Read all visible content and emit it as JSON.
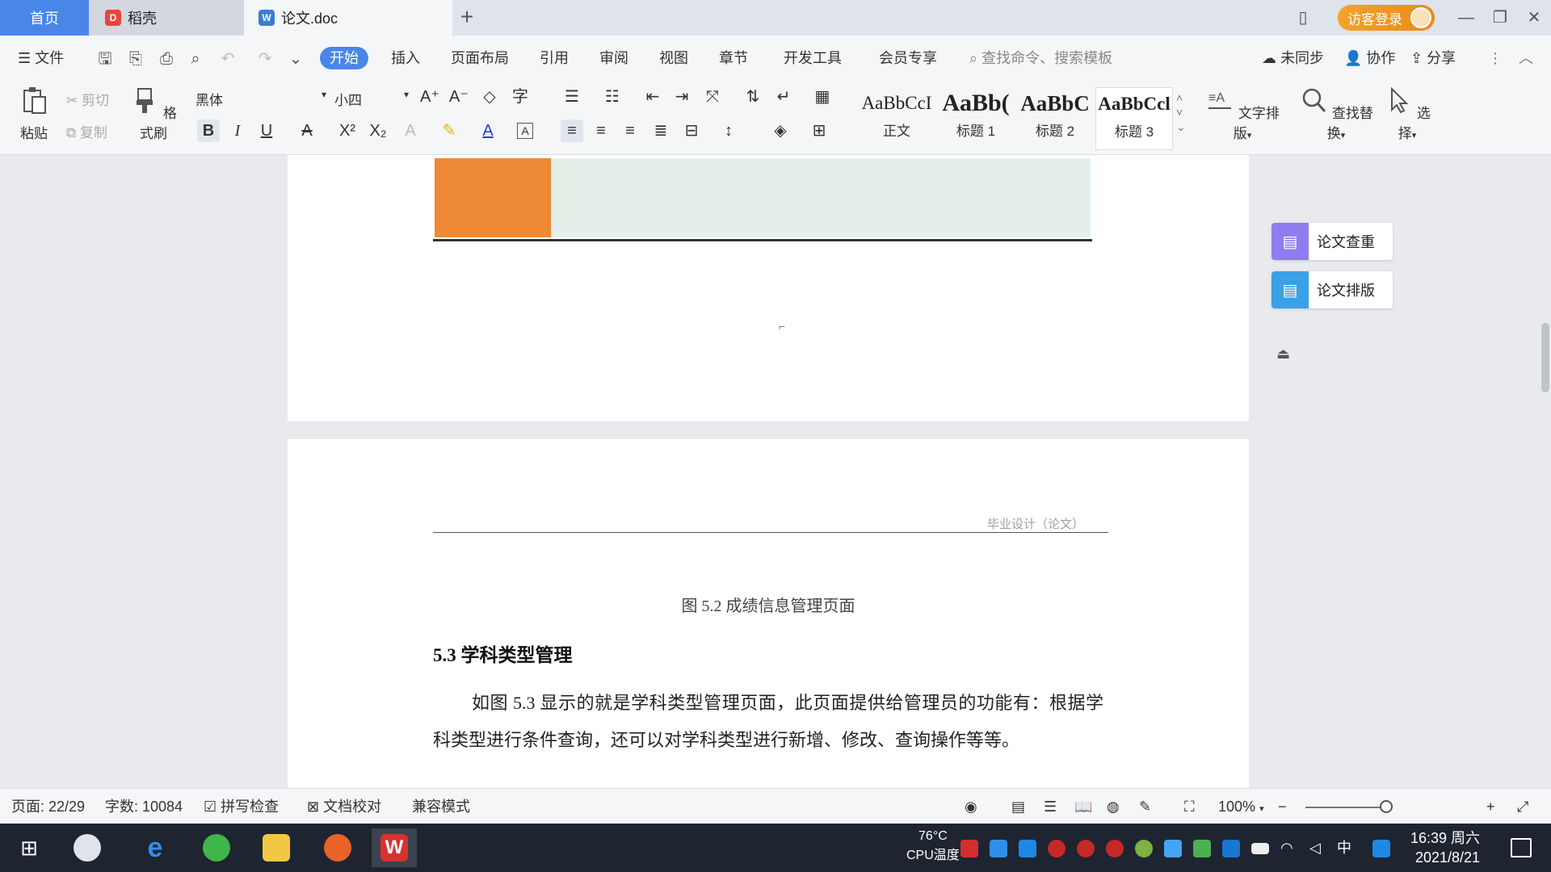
{
  "titlebar": {
    "tab_home": "首页",
    "tab_daoke": "稻壳",
    "tab_doc": "论文.doc",
    "add_tab": "+",
    "login": "访客登录"
  },
  "menubar": {
    "file": "文件",
    "items": [
      "开始",
      "插入",
      "页面布局",
      "引用",
      "审阅",
      "视图",
      "章节",
      "开发工具",
      "会员专享"
    ],
    "search_placeholder": "查找命令、搜索模板",
    "sync": "未同步",
    "collab": "协作",
    "share": "分享"
  },
  "ribbon": {
    "paste": "粘贴",
    "cut": "剪切",
    "copy": "复制",
    "format_painter": "格式刷",
    "font_name": "黑体",
    "font_size": "小四",
    "styles": [
      {
        "sample": "AaBbCcI",
        "label": "正文"
      },
      {
        "sample": "AaBb(",
        "label": "标题 1"
      },
      {
        "sample": "AaBbC",
        "label": "标题 2"
      },
      {
        "sample": "AaBbCcl",
        "label": "标题 3"
      }
    ],
    "text_layout": "文字排版",
    "find_replace": "查找替换",
    "select": "选择"
  },
  "document": {
    "header_text": "毕业设计（论文）",
    "figure_caption": "图 5.2  成绩信息管理页面",
    "section_title": "5.3 学科类型管理",
    "paragraph": "如图 5.3 显示的就是学科类型管理页面，此页面提供给管理员的功能有：根据学科类型进行条件查询，还可以对学科类型进行新增、修改、查询操作等等。"
  },
  "side_panel": {
    "plagiarism_check": "论文查重",
    "thesis_layout": "论文排版"
  },
  "statusbar": {
    "page": "页面: 22/29",
    "word_count": "字数: 10084",
    "spell_check": "拼写检查",
    "proofread": "文档校对",
    "compat_mode": "兼容模式",
    "zoom": "100%"
  },
  "taskbar": {
    "cpu_temp": "76°C",
    "cpu_label": "CPU温度",
    "ime": "中",
    "time": "16:39 周六",
    "date": "2021/8/21"
  },
  "colors": {
    "accent": "#4a86e8",
    "login": "#f4a32c",
    "orange_block": "#ee8a35",
    "side_icon_purple": "#8f7cf0",
    "side_icon_blue": "#3aa0e8"
  }
}
